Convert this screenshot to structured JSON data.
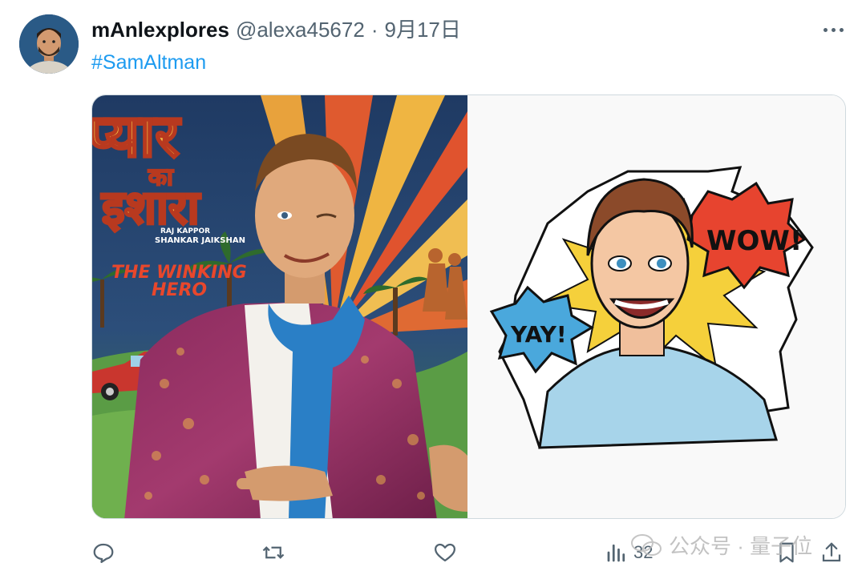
{
  "tweet": {
    "display_name": "mAnlexplores",
    "handle": "@alexa45672",
    "separator": "·",
    "date": "9月17日",
    "hashtag": "#SamAltman"
  },
  "poster": {
    "title_line1": "प्यार",
    "title_line2": "का",
    "title_line3": "इशारा",
    "credit1": "RAJ KAPPOR",
    "credit2": "SHANKAR JAIKSHAN",
    "tagline1": "THE WINKING",
    "tagline2": "HERO"
  },
  "sticker": {
    "bubble1": "WOW!",
    "bubble2": "YAY!"
  },
  "actions": {
    "reply_icon": "reply-icon",
    "retweet_icon": "retweet-icon",
    "like_icon": "heart-icon",
    "views_icon": "views-icon",
    "views_count": "32",
    "bookmark_icon": "bookmark-icon",
    "share_icon": "share-icon"
  },
  "watermark": {
    "text": "公众号 · 量子位"
  },
  "colors": {
    "link": "#1d9bf0",
    "muted": "#536471"
  }
}
